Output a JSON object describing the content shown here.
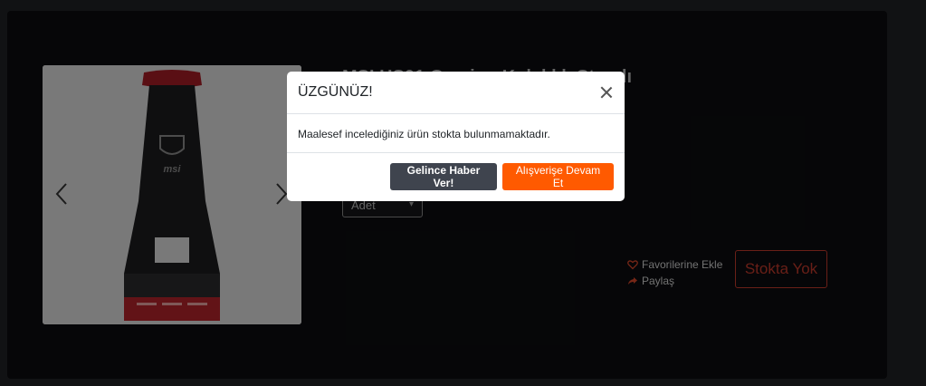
{
  "product": {
    "title": "MSI HS01 Gaming Kulaklık Standı",
    "quantity_placeholder": "Adet",
    "favorite_label": "Favorilerine Ekle",
    "share_label": "Paylaş",
    "stock_button_label": "Stokta Yok",
    "image_logo_text": "msi"
  },
  "modal": {
    "title": "ÜZGÜNÜZ!",
    "message": "Maalesef incelediğiniz ürün stokta bulunmamaktadır.",
    "notify_button_label": "Gelince Haber Ver!",
    "continue_button_label": "Alışverişe Devam Et"
  },
  "colors": {
    "accent_orange": "#ff5a00",
    "dark_button": "#3f444e",
    "stock_red": "#c0392b",
    "page_background": "#0b0c0f"
  }
}
